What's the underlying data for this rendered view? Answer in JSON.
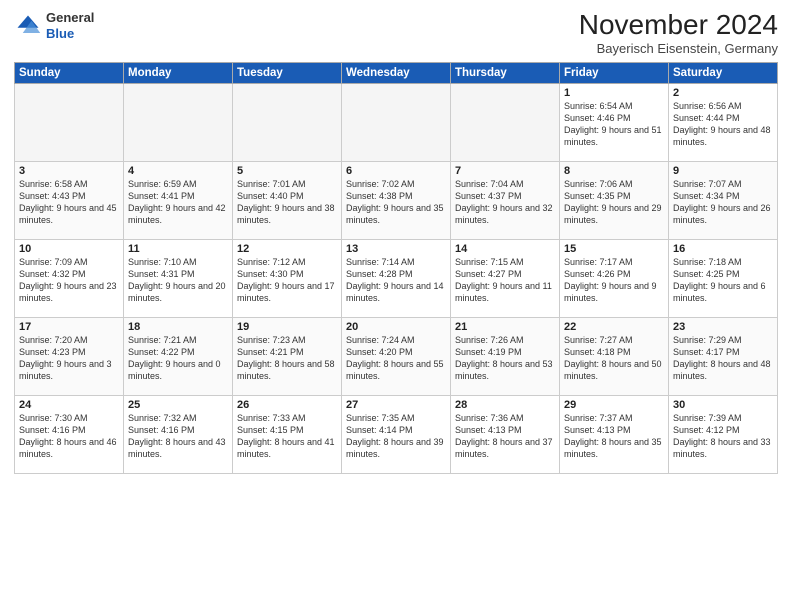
{
  "header": {
    "logo_general": "General",
    "logo_blue": "Blue",
    "month_title": "November 2024",
    "subtitle": "Bayerisch Eisenstein, Germany"
  },
  "weekdays": [
    "Sunday",
    "Monday",
    "Tuesday",
    "Wednesday",
    "Thursday",
    "Friday",
    "Saturday"
  ],
  "weeks": [
    [
      {
        "day": "",
        "info": ""
      },
      {
        "day": "",
        "info": ""
      },
      {
        "day": "",
        "info": ""
      },
      {
        "day": "",
        "info": ""
      },
      {
        "day": "",
        "info": ""
      },
      {
        "day": "1",
        "info": "Sunrise: 6:54 AM\nSunset: 4:46 PM\nDaylight: 9 hours\nand 51 minutes."
      },
      {
        "day": "2",
        "info": "Sunrise: 6:56 AM\nSunset: 4:44 PM\nDaylight: 9 hours\nand 48 minutes."
      }
    ],
    [
      {
        "day": "3",
        "info": "Sunrise: 6:58 AM\nSunset: 4:43 PM\nDaylight: 9 hours\nand 45 minutes."
      },
      {
        "day": "4",
        "info": "Sunrise: 6:59 AM\nSunset: 4:41 PM\nDaylight: 9 hours\nand 42 minutes."
      },
      {
        "day": "5",
        "info": "Sunrise: 7:01 AM\nSunset: 4:40 PM\nDaylight: 9 hours\nand 38 minutes."
      },
      {
        "day": "6",
        "info": "Sunrise: 7:02 AM\nSunset: 4:38 PM\nDaylight: 9 hours\nand 35 minutes."
      },
      {
        "day": "7",
        "info": "Sunrise: 7:04 AM\nSunset: 4:37 PM\nDaylight: 9 hours\nand 32 minutes."
      },
      {
        "day": "8",
        "info": "Sunrise: 7:06 AM\nSunset: 4:35 PM\nDaylight: 9 hours\nand 29 minutes."
      },
      {
        "day": "9",
        "info": "Sunrise: 7:07 AM\nSunset: 4:34 PM\nDaylight: 9 hours\nand 26 minutes."
      }
    ],
    [
      {
        "day": "10",
        "info": "Sunrise: 7:09 AM\nSunset: 4:32 PM\nDaylight: 9 hours\nand 23 minutes."
      },
      {
        "day": "11",
        "info": "Sunrise: 7:10 AM\nSunset: 4:31 PM\nDaylight: 9 hours\nand 20 minutes."
      },
      {
        "day": "12",
        "info": "Sunrise: 7:12 AM\nSunset: 4:30 PM\nDaylight: 9 hours\nand 17 minutes."
      },
      {
        "day": "13",
        "info": "Sunrise: 7:14 AM\nSunset: 4:28 PM\nDaylight: 9 hours\nand 14 minutes."
      },
      {
        "day": "14",
        "info": "Sunrise: 7:15 AM\nSunset: 4:27 PM\nDaylight: 9 hours\nand 11 minutes."
      },
      {
        "day": "15",
        "info": "Sunrise: 7:17 AM\nSunset: 4:26 PM\nDaylight: 9 hours\nand 9 minutes."
      },
      {
        "day": "16",
        "info": "Sunrise: 7:18 AM\nSunset: 4:25 PM\nDaylight: 9 hours\nand 6 minutes."
      }
    ],
    [
      {
        "day": "17",
        "info": "Sunrise: 7:20 AM\nSunset: 4:23 PM\nDaylight: 9 hours\nand 3 minutes."
      },
      {
        "day": "18",
        "info": "Sunrise: 7:21 AM\nSunset: 4:22 PM\nDaylight: 9 hours\nand 0 minutes."
      },
      {
        "day": "19",
        "info": "Sunrise: 7:23 AM\nSunset: 4:21 PM\nDaylight: 8 hours\nand 58 minutes."
      },
      {
        "day": "20",
        "info": "Sunrise: 7:24 AM\nSunset: 4:20 PM\nDaylight: 8 hours\nand 55 minutes."
      },
      {
        "day": "21",
        "info": "Sunrise: 7:26 AM\nSunset: 4:19 PM\nDaylight: 8 hours\nand 53 minutes."
      },
      {
        "day": "22",
        "info": "Sunrise: 7:27 AM\nSunset: 4:18 PM\nDaylight: 8 hours\nand 50 minutes."
      },
      {
        "day": "23",
        "info": "Sunrise: 7:29 AM\nSunset: 4:17 PM\nDaylight: 8 hours\nand 48 minutes."
      }
    ],
    [
      {
        "day": "24",
        "info": "Sunrise: 7:30 AM\nSunset: 4:16 PM\nDaylight: 8 hours\nand 46 minutes."
      },
      {
        "day": "25",
        "info": "Sunrise: 7:32 AM\nSunset: 4:16 PM\nDaylight: 8 hours\nand 43 minutes."
      },
      {
        "day": "26",
        "info": "Sunrise: 7:33 AM\nSunset: 4:15 PM\nDaylight: 8 hours\nand 41 minutes."
      },
      {
        "day": "27",
        "info": "Sunrise: 7:35 AM\nSunset: 4:14 PM\nDaylight: 8 hours\nand 39 minutes."
      },
      {
        "day": "28",
        "info": "Sunrise: 7:36 AM\nSunset: 4:13 PM\nDaylight: 8 hours\nand 37 minutes."
      },
      {
        "day": "29",
        "info": "Sunrise: 7:37 AM\nSunset: 4:13 PM\nDaylight: 8 hours\nand 35 minutes."
      },
      {
        "day": "30",
        "info": "Sunrise: 7:39 AM\nSunset: 4:12 PM\nDaylight: 8 hours\nand 33 minutes."
      }
    ]
  ]
}
